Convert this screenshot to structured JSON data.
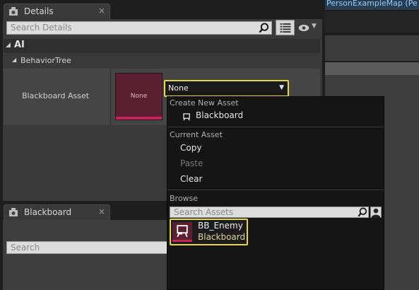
{
  "map_tab": {
    "title": "PersonExampleMap (Pe"
  },
  "details": {
    "tab_title": "Details",
    "close_glyph": "×",
    "search_placeholder": "Search Details",
    "category": "AI",
    "subcategory": "BehaviorTree",
    "property_label": "Blackboard Asset",
    "thumbnail_label": "None",
    "combo_value": "None"
  },
  "dropdown": {
    "create_header": "Create New Asset",
    "create_item": "Blackboard",
    "current_header": "Current Asset",
    "copy": "Copy",
    "paste": "Paste",
    "clear": "Clear",
    "browse_header": "Browse",
    "search_placeholder": "Search Assets",
    "asset_name": "BB_Enemy",
    "asset_type": "Blackboard"
  },
  "blackboard_panel": {
    "tab_title": "Blackboard",
    "close_glyph": "×",
    "search_placeholder": "Search"
  },
  "colors": {
    "highlight": "#e6d93a",
    "thumbnail_bg": "#5a1f30",
    "blackboard_accent": "#c8245a"
  }
}
